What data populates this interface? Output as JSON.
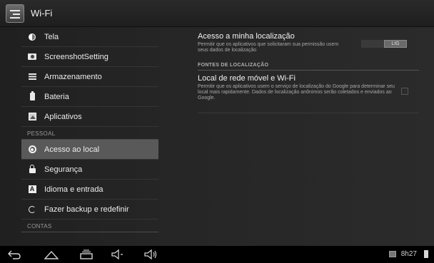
{
  "action_bar": {
    "title": "Wi-Fi",
    "icon": "settings-sliders-icon"
  },
  "sidebar": {
    "items_top": [
      {
        "label": "Tela",
        "icon": "display-brightness-icon"
      },
      {
        "label": "ScreenshotSetting",
        "icon": "camera-icon"
      },
      {
        "label": "Armazenamento",
        "icon": "storage-icon"
      },
      {
        "label": "Bateria",
        "icon": "battery-icon"
      },
      {
        "label": "Aplicativos",
        "icon": "apps-icon"
      }
    ],
    "section_pessoal": "PESSOAL",
    "items_pessoal": [
      {
        "label": "Acesso ao local",
        "icon": "location-target-icon",
        "selected": true
      },
      {
        "label": "Segurança",
        "icon": "lock-icon"
      },
      {
        "label": "Idioma e entrada",
        "icon": "language-icon",
        "glyph": "A"
      },
      {
        "label": "Fazer backup e redefinir",
        "icon": "backup-icon"
      }
    ],
    "section_contas": "CONTAS"
  },
  "location": {
    "access": {
      "title": "Acesso a minha localização",
      "summary": "Permitir que os aplicativos que solicitaram sua permissão usem seus dados de localização",
      "toggle_label": "LIG"
    },
    "category": "FONTES DE LOCALIZAÇÃO",
    "network": {
      "title": "Local de rede móvel e Wi-Fi",
      "summary": "Permitir que os aplicativos usem o serviço de localização do Google para determinar seu local mais rapidamente. Dados de localização anônimos serão coletados e enviados ao Google.",
      "checked": false
    }
  },
  "system_bar": {
    "clock": "8h27",
    "nav": [
      "back-icon",
      "home-icon",
      "recent-apps-icon",
      "volume-down-icon",
      "volume-up-icon"
    ]
  },
  "colors": {
    "selected_item": "#595959",
    "background": "#262626",
    "system_bar": "#000000"
  }
}
